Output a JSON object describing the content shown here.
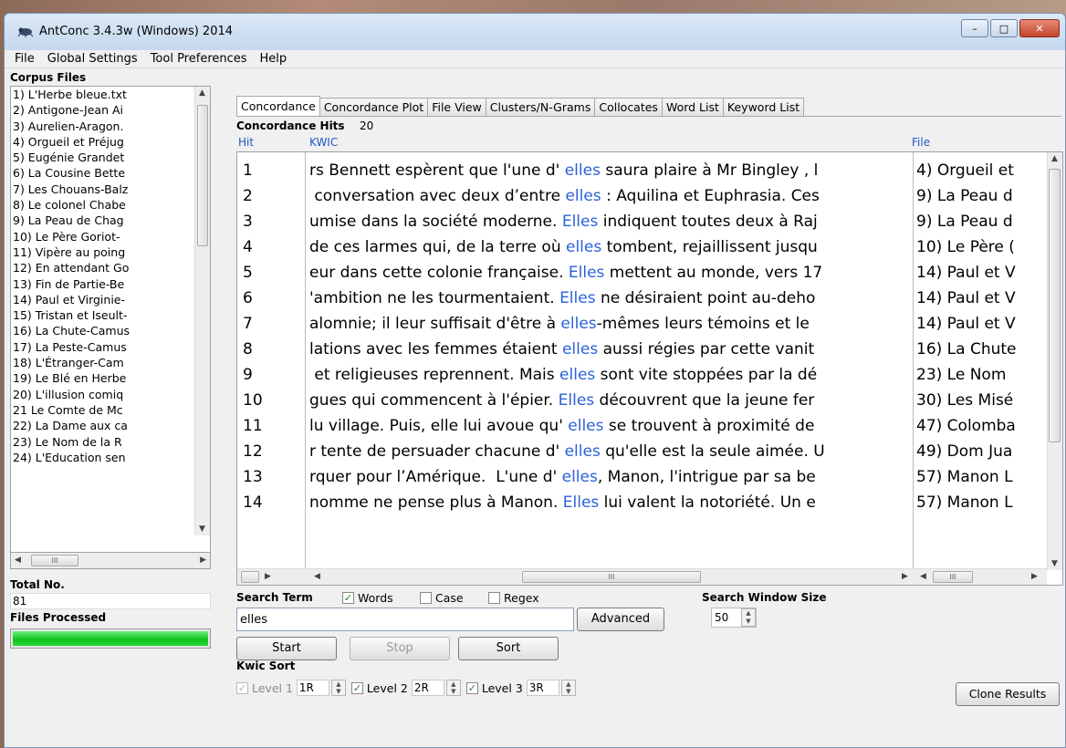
{
  "window": {
    "title": "AntConc 3.4.3w (Windows) 2014",
    "buttons": {
      "minimize": "–",
      "maximize": "□",
      "close": "✕"
    }
  },
  "menu": [
    "File",
    "Global Settings",
    "Tool Preferences",
    "Help"
  ],
  "corpus": {
    "title": "Corpus Files",
    "items": [
      "1) L'Herbe bleue.txt",
      "2) Antigone-Jean Ai",
      "3) Aurelien-Aragon.",
      "4) Orgueil et Préjug",
      "5) Eugénie Grandet",
      "6) La Cousine Bette",
      "7) Les Chouans-Balz",
      "8) Le colonel Chabe",
      "9) La Peau de Chag",
      "10) Le Père Goriot-",
      "11) Vipère au poing",
      "12) En attendant Go",
      "13) Fin de Partie-Be",
      "14) Paul et Virginie-",
      "15) Tristan et Iseult-",
      "16) La Chute-Camus",
      "17) La Peste-Camus",
      "18) L'Étranger-Cam",
      "19) Le Blé en Herbe",
      "20) L'illusion comiq",
      "21 Le Comte de Mc",
      "22) La Dame aux ca",
      "23) Le Nom de la R",
      "24) L'Education sen"
    ],
    "total_label": "Total No.",
    "total_value": "81",
    "files_processed_label": "Files Processed",
    "progress_fraction": 1.0
  },
  "tabs": [
    "Concordance",
    "Concordance Plot",
    "File View",
    "Clusters/N-Grams",
    "Collocates",
    "Word List",
    "Keyword List"
  ],
  "active_tab": "Concordance",
  "concordance": {
    "hits_label": "Concordance Hits",
    "hits_value": "20",
    "headers": {
      "hit": "Hit",
      "kwic": "KWIC",
      "file": "File"
    },
    "rows": [
      {
        "hit": "1",
        "left": "rs Bennett espèrent que l'une d' ",
        "kw": "elles",
        "right": " saura plaire à Mr Bingley , l",
        "file": "4) Orgueil et"
      },
      {
        "hit": "2",
        "left": " conversation avec deux d’entre ",
        "kw": "elles",
        "right": " : Aquilina et Euphrasia. Ces",
        "file": "9) La Peau d"
      },
      {
        "hit": "3",
        "left": "umise dans la société moderne. ",
        "kw": "Elles",
        "right": " indiquent toutes deux à Raj",
        "file": "9) La Peau d"
      },
      {
        "hit": "4",
        "left": "de ces larmes qui, de la terre où ",
        "kw": "elles",
        "right": " tombent, rejaillissent jusqu",
        "file": "10) Le Père ("
      },
      {
        "hit": "5",
        "left": "eur dans cette colonie française. ",
        "kw": "Elles",
        "right": " mettent au monde, vers 17",
        "file": "14) Paul et V"
      },
      {
        "hit": "6",
        "left": "'ambition ne les tourmentaient. ",
        "kw": "Elles",
        "right": " ne désiraient point au-deho",
        "file": "14) Paul et V"
      },
      {
        "hit": "7",
        "left": "alomnie; il leur suffisait d'être à ",
        "kw": "elles",
        "right": "-mêmes leurs témoins et le",
        "file": "14) Paul et V"
      },
      {
        "hit": "8",
        "left": "lations avec les femmes étaient ",
        "kw": "elles",
        "right": " aussi régies par cette vanit",
        "file": "16) La Chute"
      },
      {
        "hit": "9",
        "left": " et religieuses reprennent. Mais ",
        "kw": "elles",
        "right": " sont vite stoppées par la dé",
        "file": "23) Le Nom"
      },
      {
        "hit": "10",
        "left": "gues qui commencent à l'épier. ",
        "kw": "Elles",
        "right": " découvrent que la jeune fer",
        "file": "30) Les Misé"
      },
      {
        "hit": "11",
        "left": "lu village. Puis, elle lui avoue qu' ",
        "kw": "elles",
        "right": " se trouvent à proximité de",
        "file": "47) Colomba"
      },
      {
        "hit": "12",
        "left": "r tente de persuader chacune d' ",
        "kw": "elles",
        "right": " qu'elle est la seule aimée. U",
        "file": "49) Dom Jua"
      },
      {
        "hit": "13",
        "left": "rquer pour l’Amérique.  L'une d' ",
        "kw": "elles",
        "right": ", Manon, l'intrigue par sa be",
        "file": "57) Manon L"
      },
      {
        "hit": "14",
        "left": "nomme ne pense plus à Manon. ",
        "kw": "Elles",
        "right": " lui valent la notoriété. Un e",
        "file": "57) Manon L"
      }
    ]
  },
  "search": {
    "term_label": "Search Term",
    "words_label": "Words",
    "words_checked": true,
    "case_label": "Case",
    "case_checked": false,
    "regex_label": "Regex",
    "regex_checked": false,
    "value": "elles",
    "advanced_label": "Advanced",
    "window_size_label": "Search Window Size",
    "window_size_value": "50",
    "start_label": "Start",
    "stop_label": "Stop",
    "sort_label": "Sort"
  },
  "kwic_sort": {
    "label": "Kwic Sort",
    "level1_label": "Level 1",
    "level1_value": "1R",
    "level2_label": "Level 2",
    "level2_value": "2R",
    "level3_label": "Level 3",
    "level3_value": "3R",
    "clone_label": "Clone Results"
  },
  "colors": {
    "keyword": "#2a62d9",
    "progress": "#12c21e",
    "header_text": "#1f56c6"
  }
}
